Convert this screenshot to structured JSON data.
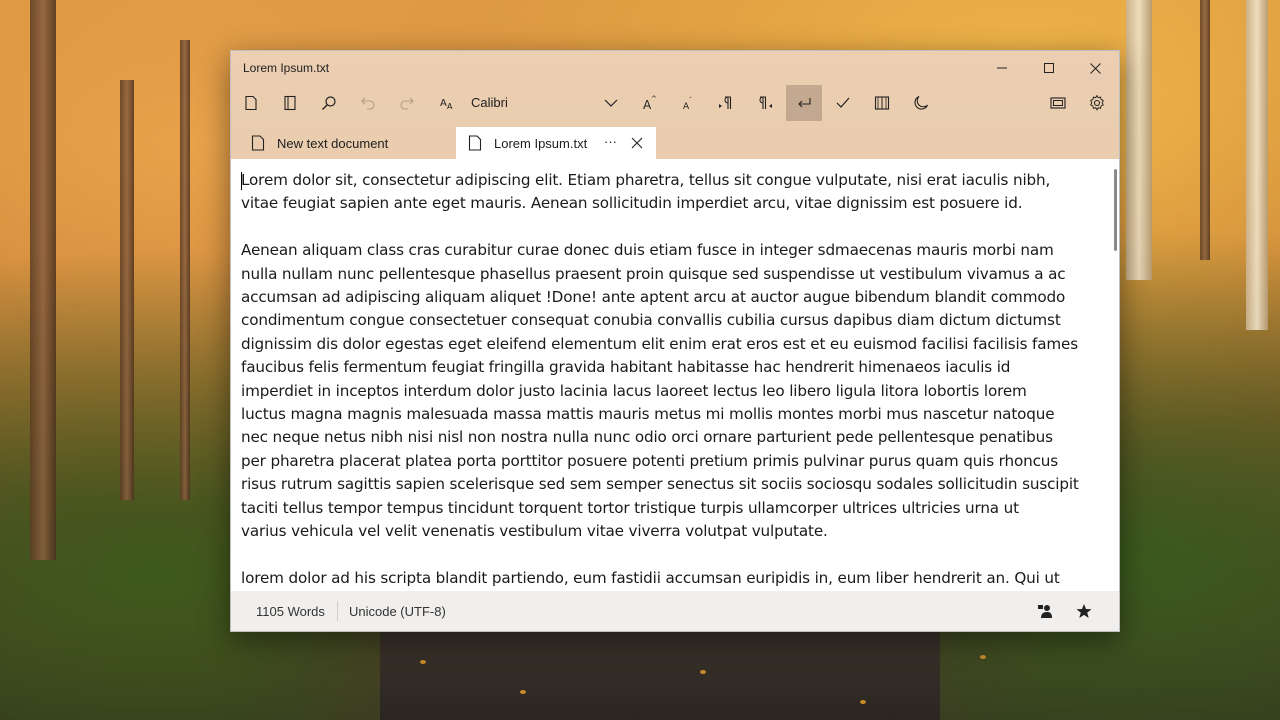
{
  "window": {
    "title": "Lorem Ipsum.txt"
  },
  "toolbar": {
    "font_name": "Calibri",
    "icons": [
      "new-file-icon",
      "open-file-icon",
      "search-icon",
      "undo-icon",
      "redo-icon",
      "font-icon",
      "chevron-down-icon",
      "font-increase-icon",
      "font-decrease-icon",
      "ltr-icon",
      "rtl-icon",
      "word-wrap-icon",
      "spell-check-icon",
      "reading-view-icon",
      "dark-mode-icon",
      "compact-overlay-icon",
      "settings-icon"
    ]
  },
  "tabs": [
    {
      "label": "New text document",
      "active": false
    },
    {
      "label": "Lorem Ipsum.txt",
      "active": true,
      "more": "···"
    }
  ],
  "editor": {
    "content": "Lorem dolor sit, consectetur adipiscing elit. Etiam pharetra, tellus sit congue vulputate, nisi erat iaculis nibh,\nvitae feugiat sapien ante eget mauris. Aenean sollicitudin imperdiet arcu, vitae dignissim est posuere id.\n\nAenean aliquam class cras curabitur curae donec duis etiam fusce in integer sdmaecenas mauris morbi nam\nnulla nullam nunc pellentesque phasellus praesent proin quisque sed suspendisse ut vestibulum vivamus a ac\naccumsan ad adipiscing aliquam aliquet !Done! ante aptent arcu at auctor augue bibendum blandit commodo\ncondimentum congue consectetuer consequat conubia convallis cubilia cursus dapibus diam dictum dictumst\ndignissim dis dolor egestas eget eleifend elementum elit enim erat eros est et eu euismod facilisi facilisis fames\nfaucibus felis fermentum feugiat fringilla gravida habitant habitasse hac hendrerit himenaeos iaculis id\nimperdiet in inceptos interdum dolor justo lacinia lacus laoreet lectus leo libero ligula litora lobortis lorem\nluctus magna magnis malesuada massa mattis mauris metus mi mollis montes morbi mus nascetur natoque\nnec neque netus nibh nisi nisl non nostra nulla nunc odio orci ornare parturient pede pellentesque penatibus\nper pharetra placerat platea porta porttitor posuere potenti pretium primis pulvinar purus quam quis rhoncus\nrisus rutrum sagittis sapien scelerisque sed sem semper senectus sit sociis sociosqu sodales sollicitudin suscipit\ntaciti tellus tempor tempus tincidunt torquent tortor tristique turpis ullamcorper ultrices ultricies urna ut\nvarius vehicula vel velit venenatis vestibulum vitae viverra volutpat vulputate.\n\nlorem dolor ad his scripta blandit partiendo, eum fastidii accumsan euripidis in, eum liber hendrerit an. Qui ut"
  },
  "status": {
    "word_count": "1105 Words",
    "encoding": "Unicode (UTF-8)"
  },
  "colors": {
    "chrome": "#ebcdaf",
    "editor_bg": "#ffffff",
    "status_bg": "#f1efed"
  }
}
